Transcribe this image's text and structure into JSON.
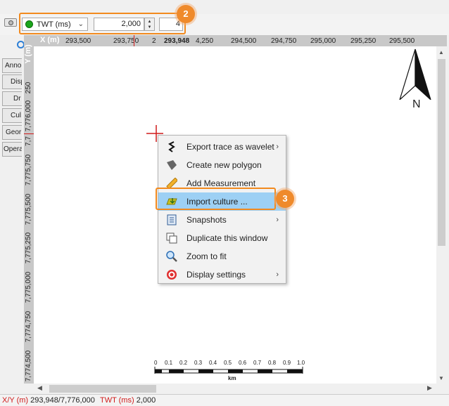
{
  "toolbar": {
    "domain": "TWT (ms)",
    "time_value": "2,000",
    "step_value": "4",
    "callout": "2"
  },
  "side_tabs": [
    "Anno",
    "Disp",
    "Dr",
    "Cul",
    "Geor",
    "Opera"
  ],
  "x_axis": {
    "label": "X (m)",
    "ticks": [
      "293,500",
      "293,750",
      "2",
      "293,948",
      "4,250",
      "294,500",
      "294,750",
      "295,000",
      "295,250",
      "295,500"
    ]
  },
  "y_axis": {
    "label": "Y (m)",
    "ticks": [
      "250",
      "7,776,000",
      "7,7",
      "7,775,750",
      "7,775,500",
      "7,775,250",
      "7,775,000",
      "7,774,750",
      "7,774,500"
    ]
  },
  "north_label": "N",
  "scale_bar": {
    "labels": [
      "0",
      "0.1",
      "0.2",
      "0.3",
      "0.4",
      "0.5",
      "0.6",
      "0.7",
      "0.8",
      "0.9",
      "1.0"
    ],
    "unit": "km"
  },
  "context_menu": {
    "items": [
      {
        "label": "Export trace as wavelet",
        "icon": "wavelet-icon",
        "submenu": true
      },
      {
        "label": "Create new polygon",
        "icon": "polygon-icon",
        "submenu": false
      },
      {
        "label": "Add Measurement",
        "icon": "ruler-icon",
        "submenu": false
      },
      {
        "label": "Import culture ...",
        "icon": "import-culture-icon",
        "submenu": false,
        "highlighted": true
      },
      {
        "label": "Snapshots",
        "icon": "snapshot-icon",
        "submenu": true
      },
      {
        "label": "Duplicate this window",
        "icon": "duplicate-icon",
        "submenu": false
      },
      {
        "label": "Zoom to fit",
        "icon": "zoom-icon",
        "submenu": false
      },
      {
        "label": "Display settings",
        "icon": "display-settings-icon",
        "submenu": true
      }
    ],
    "callout": "3"
  },
  "status": {
    "xy_label": "X/Y (m)",
    "xy_value": "293,948/7,776,000",
    "twt_label": "TWT (ms)",
    "twt_value": "2,000"
  },
  "colors": {
    "callout": "#ef8a2b",
    "highlight": "#9dd0f4",
    "crosshair": "#d01c1c",
    "status_label": "#d01c1c"
  }
}
